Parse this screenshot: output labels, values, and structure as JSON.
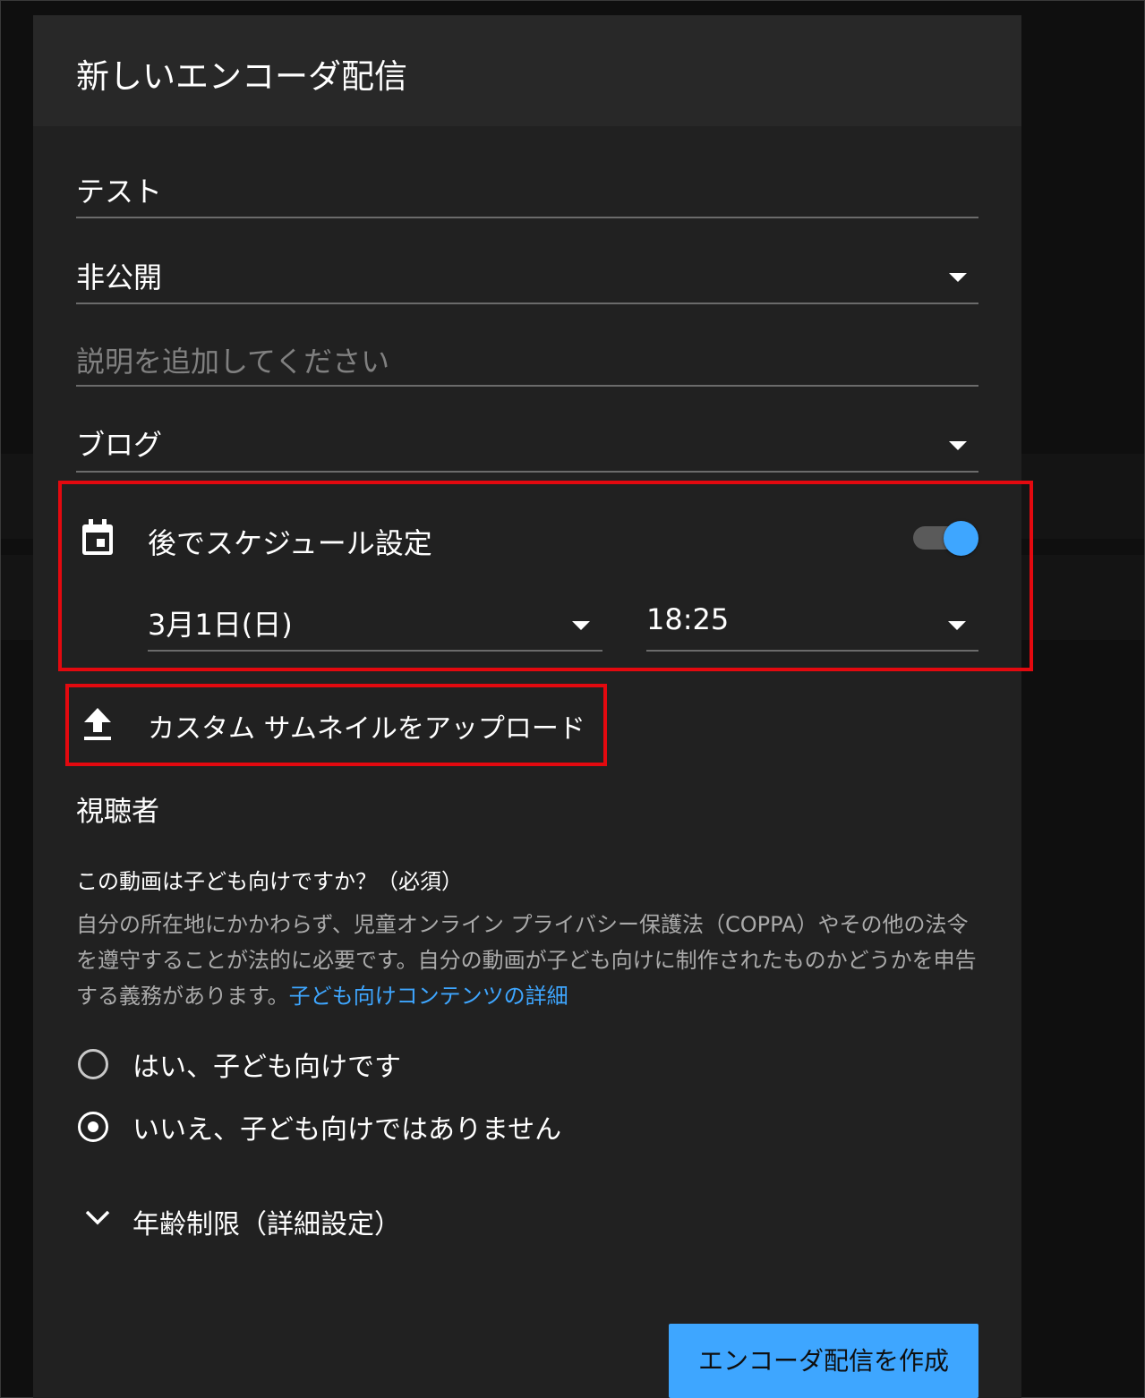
{
  "dialog": {
    "title": "新しいエンコーダ配信"
  },
  "fields": {
    "title_value": "テスト",
    "visibility_value": "非公開",
    "description_placeholder": "説明を追加してください",
    "category_value": "ブログ"
  },
  "schedule": {
    "label": "後でスケジュール設定",
    "enabled": true,
    "date_value": "3月1日(日)",
    "time_value": "18:25"
  },
  "thumbnail": {
    "upload_label": "カスタム サムネイルをアップロード"
  },
  "audience": {
    "heading": "視聴者",
    "question": "この動画は子ども向けですか？（必須）",
    "description": "自分の所在地にかかわらず、児童オンライン プライバシー保護法（COPPA）やその他の法令を遵守することが法的に必要です。自分の動画が子ども向けに制作されたものかどうかを申告する義務があります。",
    "link_text": "子ども向けコンテンツの詳細",
    "options": [
      {
        "label": "はい、子ども向けです",
        "selected": false
      },
      {
        "label": "いいえ、子ども向けではありません",
        "selected": true
      }
    ]
  },
  "age_restriction": {
    "label": "年齢制限（詳細設定）"
  },
  "actions": {
    "create_label": "エンコーダ配信を作成"
  },
  "colors": {
    "accent": "#3ea6ff",
    "highlight": "#e3090f",
    "dialog_bg": "#212121"
  }
}
